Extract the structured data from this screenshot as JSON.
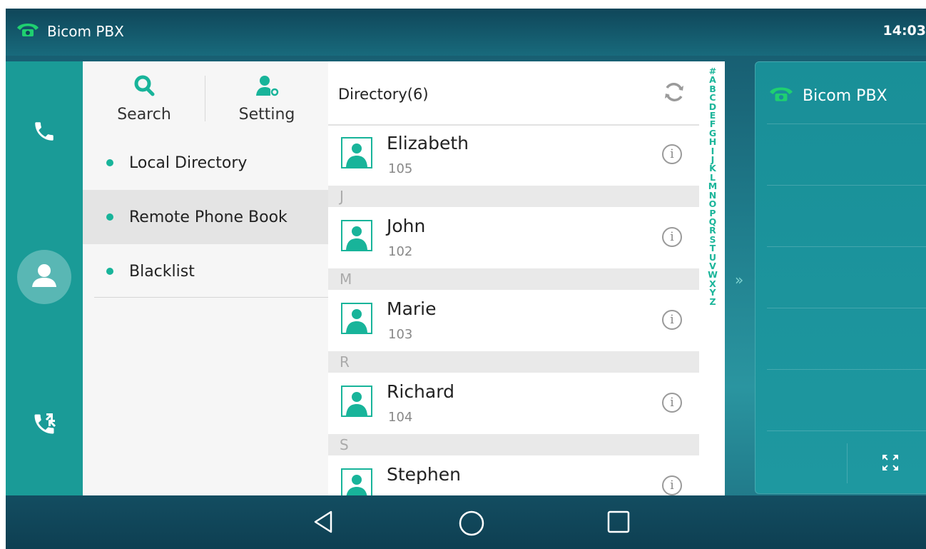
{
  "status_bar": {
    "app_name": "Bicom PBX",
    "time": "14:03"
  },
  "menu": {
    "search_label": "Search",
    "setting_label": "Setting",
    "items": [
      {
        "label": "Local Directory",
        "active": false
      },
      {
        "label": "Remote Phone Book",
        "active": true
      },
      {
        "label": "Blacklist",
        "active": false
      }
    ]
  },
  "directory": {
    "title": "Directory(6)",
    "contacts": [
      {
        "name": "Elizabeth",
        "number": "105"
      },
      {
        "name": "John",
        "number": "102"
      },
      {
        "name": "Marie",
        "number": "103"
      },
      {
        "name": "Richard",
        "number": "104"
      },
      {
        "name": "Stephen",
        "number": ""
      }
    ],
    "section_letters": [
      "J",
      "M",
      "R",
      "S"
    ],
    "alphabet": [
      "#",
      "A",
      "B",
      "C",
      "D",
      "E",
      "F",
      "G",
      "H",
      "I",
      "J",
      "K",
      "L",
      "M",
      "N",
      "O",
      "P",
      "Q",
      "R",
      "S",
      "T",
      "U",
      "V",
      "W",
      "X",
      "Y",
      "Z"
    ]
  },
  "right_panel": {
    "account_name": "Bicom PBX"
  },
  "colors": {
    "accent": "#18b49a",
    "rail": "#1a9b97",
    "info_icon": "#9a9a9a"
  }
}
